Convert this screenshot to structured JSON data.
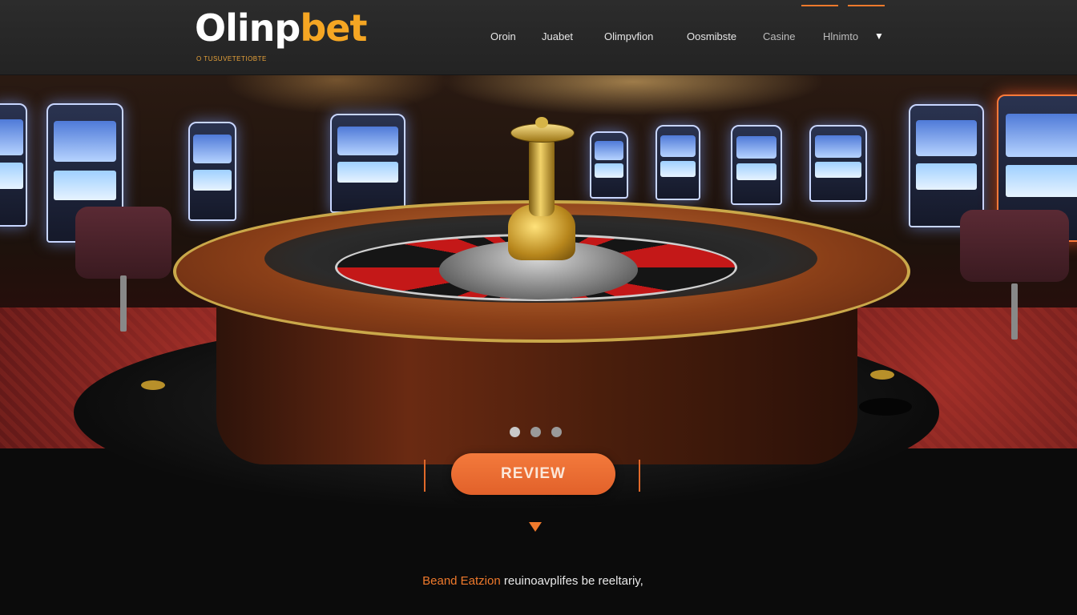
{
  "header": {
    "logo_main": "Olinp",
    "logo_accent": "bet",
    "tagline": "O TUSUVETETIOBTE"
  },
  "nav": {
    "items": [
      {
        "label": "Oroin"
      },
      {
        "label": "Juabet"
      },
      {
        "label": "Olimpvfion"
      },
      {
        "label": "Oosmibste"
      },
      {
        "label": "Casine"
      },
      {
        "label": "Hlnimto"
      }
    ],
    "dropdown_icon": "chevron-down-icon"
  },
  "hero": {
    "carousel_slides": 3,
    "active_slide": 1
  },
  "cta": {
    "label": "REVIEW"
  },
  "footer": {
    "brand": "Beand Eatzion",
    "text": "reuinoavplifes be reeltariy,"
  },
  "colors": {
    "accent": "#f07a2c",
    "header_bg": "#2a2a2a",
    "page_bg": "#0b0b0b"
  }
}
